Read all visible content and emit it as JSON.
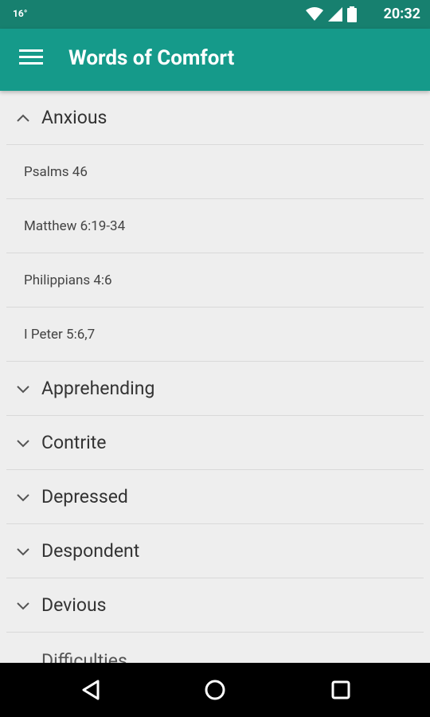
{
  "status_bar": {
    "temperature": "16°",
    "time": "20:32"
  },
  "app_bar": {
    "title": "Words of Comfort"
  },
  "categories": [
    {
      "label": "Anxious",
      "expanded": true,
      "items": [
        "Psalms 46",
        "Matthew 6:19-34",
        "Philippians 4:6",
        "I Peter 5:6,7"
      ]
    },
    {
      "label": "Apprehending",
      "expanded": false
    },
    {
      "label": "Contrite",
      "expanded": false
    },
    {
      "label": "Depressed",
      "expanded": false
    },
    {
      "label": "Despondent",
      "expanded": false
    },
    {
      "label": "Devious",
      "expanded": false
    },
    {
      "label": "Difficulties",
      "expanded": false
    }
  ],
  "colors": {
    "status_bar": "#17806f",
    "app_bar": "#159a8a",
    "background": "#eeeeee"
  },
  "icons": {
    "menu": "menu-icon",
    "back": "back-icon",
    "home": "home-icon",
    "recents": "recents-icon"
  }
}
